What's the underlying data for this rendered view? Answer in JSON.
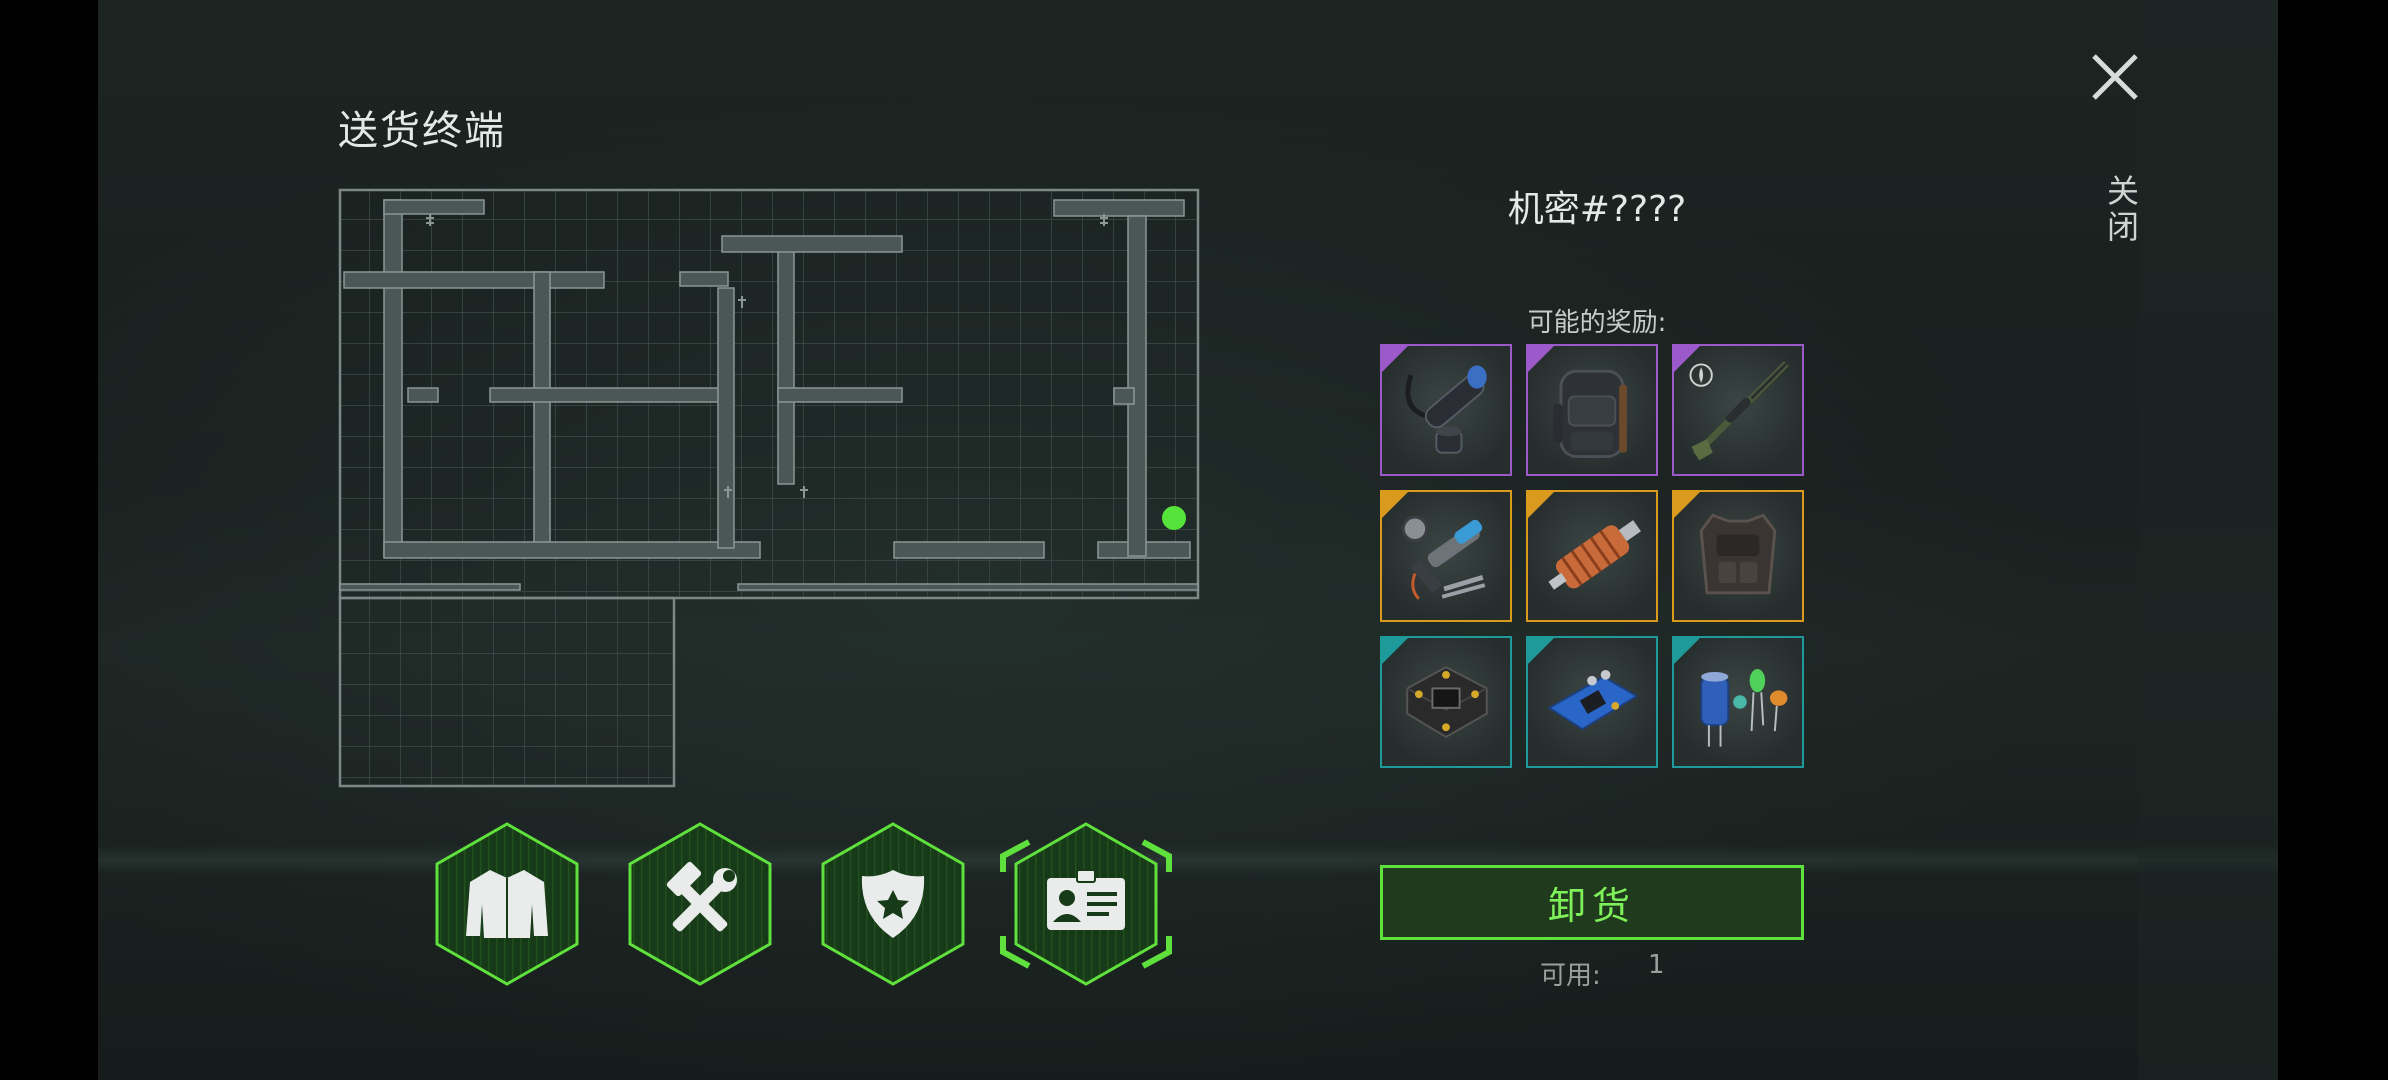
{
  "header": {
    "title": "送货终端"
  },
  "close": {
    "label": "关闭",
    "icon": "close-icon"
  },
  "panel": {
    "secret_title": "机密#????",
    "rewards_label": "可能的奖励:",
    "rewards": [
      {
        "icon": "scope-icon",
        "rarity": "purple"
      },
      {
        "icon": "backpack-icon",
        "rarity": "purple"
      },
      {
        "icon": "sniper-rifle-icon",
        "rarity": "purple"
      },
      {
        "icon": "tools-parts-icon",
        "rarity": "orange"
      },
      {
        "icon": "motor-icon",
        "rarity": "orange"
      },
      {
        "icon": "armor-vest-icon",
        "rarity": "orange"
      },
      {
        "icon": "circuit-board-icon",
        "rarity": "teal"
      },
      {
        "icon": "blue-chip-icon",
        "rarity": "teal"
      },
      {
        "icon": "capacitor-icon",
        "rarity": "teal"
      }
    ],
    "unload_label": "卸货",
    "available_label": "可用:",
    "available_value": "1"
  },
  "categories": [
    {
      "icon": "jacket-icon",
      "selected": false
    },
    {
      "icon": "hammer-wrench-icon",
      "selected": false
    },
    {
      "icon": "police-badge-icon",
      "selected": false
    },
    {
      "icon": "id-card-icon",
      "selected": true
    }
  ],
  "colors": {
    "accent_green": "#5fe03c",
    "rarity_purple": "#9b59c9",
    "rarity_orange": "#d99a1e",
    "rarity_teal": "#1f9a9a",
    "map_marker": "#55e23a"
  }
}
